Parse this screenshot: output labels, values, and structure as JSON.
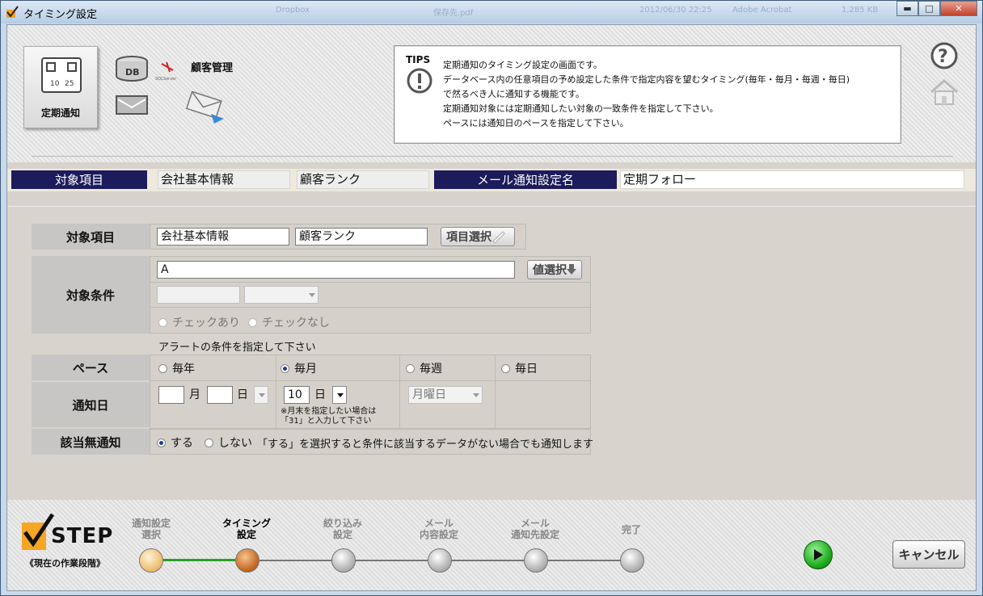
{
  "window": {
    "title": "タイミング設定",
    "ghost_tabs": [
      "Dropbox",
      "保存先.pdf",
      "2012/06/30 22:25",
      "Adobe Acrobat",
      "1,285 KB"
    ]
  },
  "header": {
    "tile_label": "定期通知",
    "db_label": "DB",
    "sqls_brand": "SQLServer",
    "customer_label": "顧客管理",
    "tips_label": "TIPS",
    "tips_lines": [
      "定期通知のタイミング設定の画面です。",
      "データベース内の任意項目の予め設定した条件で指定内容を望むタイミング(毎年・毎月・毎週・毎日)",
      "で然るべき人に通知する機能です。",
      "定期通知対象には定期通知したい対象の一致条件を指定して下さい。",
      "ペースには通知日のペースを指定して下さい。"
    ]
  },
  "summary": {
    "target_header": "対象項目",
    "target_value_1": "会社基本情報",
    "target_value_2": "顧客ランク",
    "mail_header": "メール通知設定名",
    "mail_value": "定期フォロー"
  },
  "form": {
    "target_label": "対象項目",
    "target_value_1": "会社基本情報",
    "target_value_2": "顧客ランク",
    "item_select_button": "項目選択",
    "condition_label": "対象条件",
    "condition_value": "A",
    "value_select_button": "値選択",
    "check_yes": "チェックあり",
    "check_no": "チェックなし",
    "alert_hint": "アラートの条件を指定して下さい",
    "pace_label": "ペース",
    "pace_options": [
      "毎年",
      "毎月",
      "毎週",
      "毎日"
    ],
    "pace_selected": "毎月",
    "notify_day_label": "通知日",
    "month_unit": "月",
    "day_unit": "日",
    "monthly_day_value": "10",
    "weekday_value": "月曜日",
    "month_end_note_1": "※月末を指定したい場合は",
    "month_end_note_2": "「31」と入力して下さい",
    "no_match_label": "該当無通知",
    "no_match_yes": "する",
    "no_match_no": "しない",
    "no_match_note": "「する」を選択すると条件に該当するデータがない場合でも通知します",
    "no_match_selected": "する"
  },
  "footer": {
    "step_title": "STEP",
    "step_subtitle": "《現在の作業段階》",
    "steps": [
      {
        "line1": "通知設定",
        "line2": "選択",
        "state": "done"
      },
      {
        "line1": "タイミング",
        "line2": "設定",
        "state": "current"
      },
      {
        "line1": "絞り込み",
        "line2": "設定",
        "state": "todo"
      },
      {
        "line1": "メール",
        "line2": "内容設定",
        "state": "todo"
      },
      {
        "line1": "メール",
        "line2": "通知先設定",
        "state": "todo"
      },
      {
        "line1": "完了",
        "line2": "",
        "state": "todo"
      }
    ],
    "cancel_button": "キャンセル"
  },
  "colors": {
    "header_navy": "#1c1c5c",
    "progress_green": "#2aa02a",
    "current_orange": "#c86f2c"
  }
}
